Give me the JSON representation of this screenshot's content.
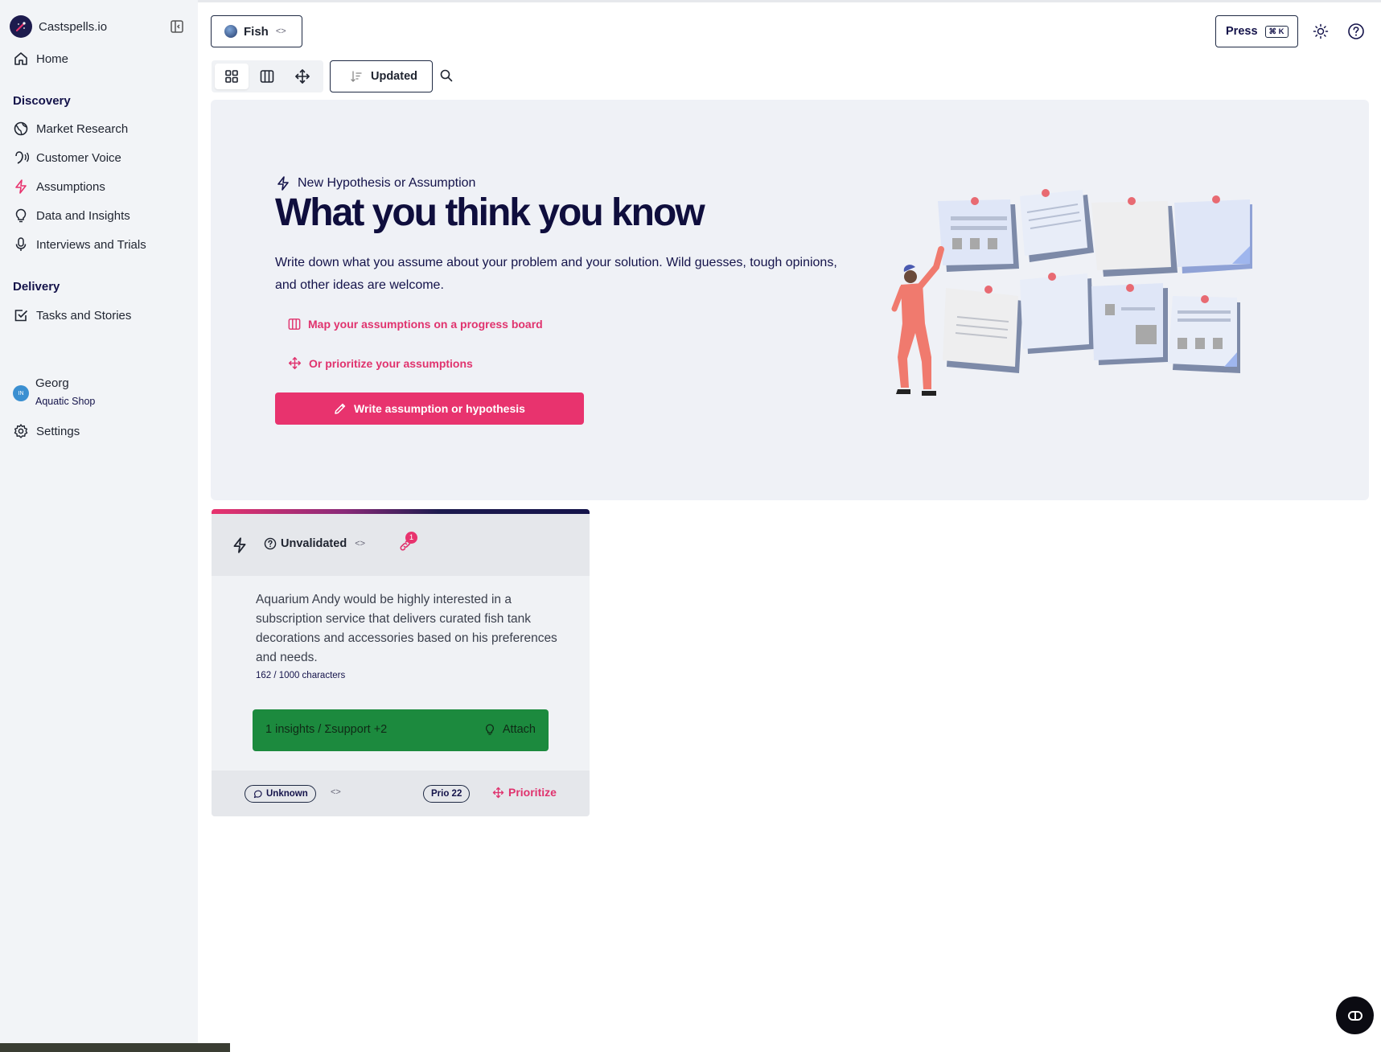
{
  "app": {
    "name": "Castspells.io"
  },
  "sidebar": {
    "home": "Home",
    "discovery_heading": "Discovery",
    "discovery_items": [
      {
        "label": "Market Research",
        "icon": "globe-icon"
      },
      {
        "label": "Customer Voice",
        "icon": "voice-icon"
      },
      {
        "label": "Assumptions",
        "icon": "bolt-icon"
      },
      {
        "label": "Data and Insights",
        "icon": "lightbulb-icon"
      },
      {
        "label": "Interviews and Trials",
        "icon": "mic-icon"
      }
    ],
    "delivery_heading": "Delivery",
    "delivery_items": [
      {
        "label": "Tasks and Stories",
        "icon": "checkbox-icon"
      }
    ],
    "user": {
      "name": "Georg",
      "org": "Aquatic Shop"
    },
    "settings": "Settings"
  },
  "header": {
    "project": "Fish",
    "press_label": "Press",
    "shortcut": "⌘ K"
  },
  "toolbar": {
    "sort_label": "Updated"
  },
  "hero": {
    "kicker": "New Hypothesis or Assumption",
    "title": "What you think you know",
    "description": "Write down what you assume about your problem and your solution. Wild guesses, tough opinions, and other ideas are welcome.",
    "link_board": "Map your assumptions on a progress board",
    "link_prioritize": "Or prioritize your assumptions",
    "cta": "Write assumption or hypothesis"
  },
  "card": {
    "status": "Unvalidated",
    "link_count": "1",
    "text": "Aquarium Andy would be highly interested in a subscription service that delivers curated fish tank decorations and accessories based on his preferences and needs.",
    "char_count": "162 / 1000 characters",
    "insights_label": "1 insights  / Σsupport +2",
    "attach": "Attach",
    "confidence": "Unknown",
    "priority": "Prio 22",
    "prioritize": "Prioritize"
  },
  "colors": {
    "accent": "#e8336e",
    "navy": "#14134a",
    "insight_green": "#1c8a3e",
    "sidebar_bg": "#f2f4f7"
  }
}
